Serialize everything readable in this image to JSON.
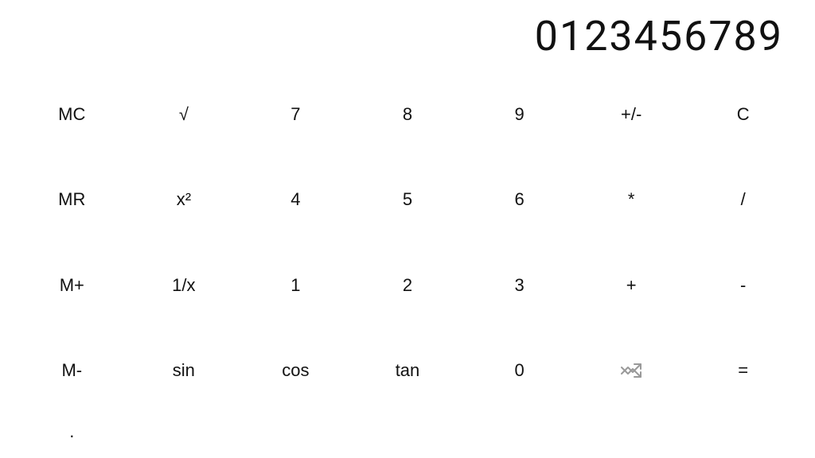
{
  "display": {
    "value": "0123456789"
  },
  "buttons": [
    [
      {
        "label": "MC",
        "name": "mc-button"
      },
      {
        "label": "√",
        "name": "sqrt-button"
      },
      {
        "label": "7",
        "name": "seven-button"
      },
      {
        "label": "8",
        "name": "eight-button"
      },
      {
        "label": "9",
        "name": "nine-button"
      },
      {
        "label": "+/-",
        "name": "plusminus-button"
      },
      {
        "label": "C",
        "name": "clear-button"
      }
    ],
    [
      {
        "label": "MR",
        "name": "mr-button"
      },
      {
        "label": "x²",
        "name": "square-button"
      },
      {
        "label": "4",
        "name": "four-button"
      },
      {
        "label": "5",
        "name": "five-button"
      },
      {
        "label": "6",
        "name": "six-button"
      },
      {
        "label": "*",
        "name": "multiply-button"
      },
      {
        "label": "/",
        "name": "divide-button"
      }
    ],
    [
      {
        "label": "M+",
        "name": "mplus-button"
      },
      {
        "label": "1/x",
        "name": "reciprocal-button"
      },
      {
        "label": "1",
        "name": "one-button"
      },
      {
        "label": "2",
        "name": "two-button"
      },
      {
        "label": "3",
        "name": "three-button"
      },
      {
        "label": "+",
        "name": "add-button"
      },
      {
        "label": "-",
        "name": "subtract-button"
      }
    ],
    [
      {
        "label": "M-",
        "name": "mminus-button"
      },
      {
        "label": "sin",
        "name": "sin-button"
      },
      {
        "label": "cos",
        "name": "cos-button"
      },
      {
        "label": "tan",
        "name": "tan-button"
      },
      {
        "label": "0",
        "name": "zero-button"
      },
      {
        "label": ".",
        "name": "decimal-button"
      },
      {
        "label": "shuffle",
        "name": "shuffle-button"
      },
      {
        "label": "=",
        "name": "equals-button"
      }
    ]
  ]
}
